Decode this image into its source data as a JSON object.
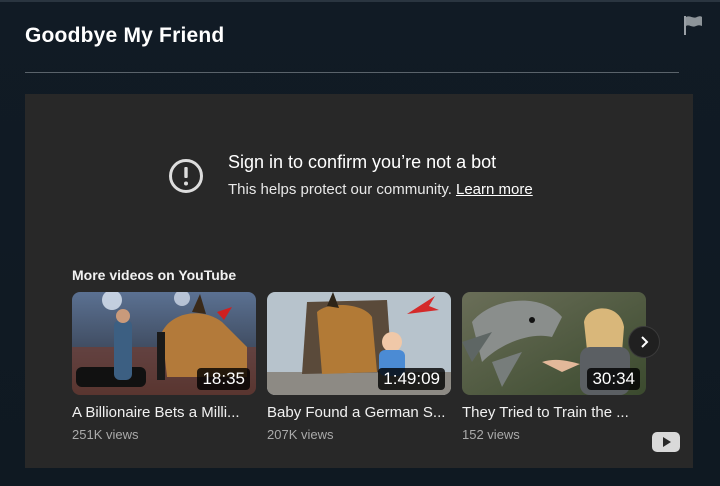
{
  "page": {
    "title": "Goodbye My Friend",
    "flag_icon": "flag-icon"
  },
  "notice": {
    "icon": "alert-circle-icon",
    "heading": "Sign in to confirm you’re not a bot",
    "body": "This helps protect our community.",
    "link": "Learn more"
  },
  "more_videos": {
    "label": "More videos on YouTube",
    "videos": [
      {
        "title": "A Billionaire Bets a Milli...",
        "views": "251K views",
        "duration": "18:35"
      },
      {
        "title": "Baby Found a German S...",
        "views": "207K views",
        "duration": "1:49:09"
      },
      {
        "title": "They Tried to Train the ...",
        "views": "152 views",
        "duration": "30:34"
      }
    ],
    "next_icon": "chevron-right-icon"
  },
  "branding": {
    "logo_icon": "youtube-logo-icon"
  },
  "colors": {
    "page_bg": "#0e1720",
    "embed_bg": "#282828",
    "text_primary": "#ffffff",
    "text_secondary": "#aaaaaa",
    "divider": "#5a636b"
  }
}
